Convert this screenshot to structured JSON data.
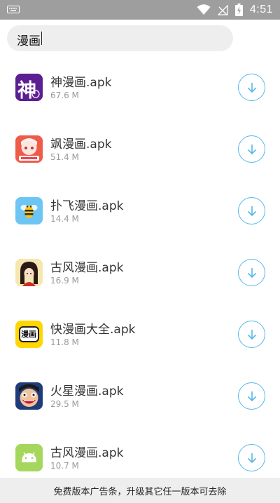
{
  "status_bar": {
    "time": "4:51"
  },
  "search": {
    "query": "漫画"
  },
  "apps": [
    {
      "name": "神漫画.apk",
      "size": "67.6 M",
      "icon": "shen-manhua-icon"
    },
    {
      "name": "飒漫画.apk",
      "size": "51.4 M",
      "icon": "sa-manhua-icon"
    },
    {
      "name": "扑飞漫画.apk",
      "size": "14.4 M",
      "icon": "pufei-manhua-icon"
    },
    {
      "name": "古风漫画.apk",
      "size": "16.9 M",
      "icon": "gufeng-manhua-icon"
    },
    {
      "name": "快漫画大全.apk",
      "size": "11.8 M",
      "icon": "kuai-manhua-icon"
    },
    {
      "name": "火星漫画.apk",
      "size": "29.5 M",
      "icon": "huoxing-manhua-icon"
    },
    {
      "name": "古风漫画.apk",
      "size": "10.7 M",
      "icon": "android-icon"
    }
  ],
  "icon_texts": {
    "shen": "神",
    "manhua": "漫画"
  },
  "banner": {
    "text": "免费版本广告条，升级其它任一版本可去除"
  },
  "colors": {
    "accent": "#55b8ea",
    "status_bar": "#9e9e9e",
    "search_bg": "#eeeeee"
  }
}
